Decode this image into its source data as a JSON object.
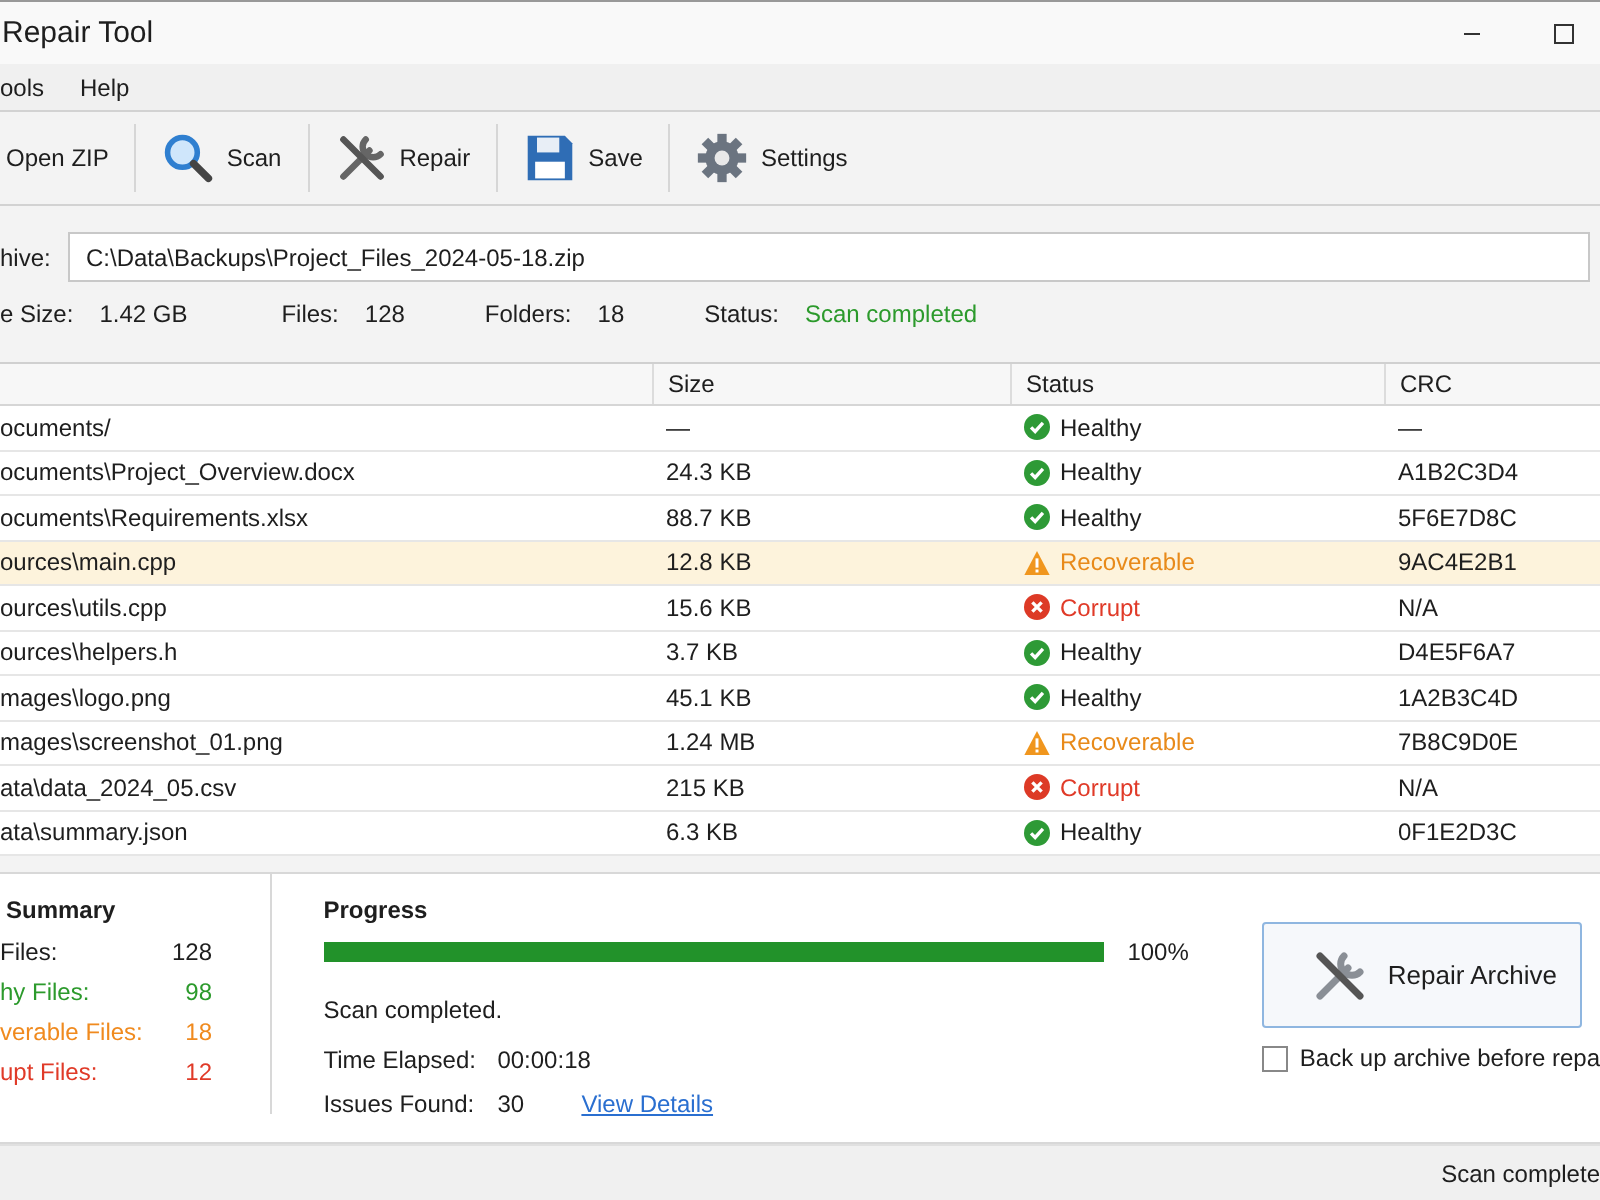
{
  "window": {
    "title": "Repair Tool"
  },
  "menu": [
    {
      "label": "ools"
    },
    {
      "label": "Help"
    }
  ],
  "toolbar": [
    {
      "label": "Open ZIP",
      "kind": "open"
    },
    {
      "label": "Scan",
      "kind": "scan"
    },
    {
      "label": "Repair",
      "kind": "repair"
    },
    {
      "label": "Save",
      "kind": "save"
    },
    {
      "label": "Settings",
      "kind": "settings"
    }
  ],
  "archive": {
    "label": "hive:",
    "value": "C:\\Data\\Backups\\Project_Files_2024-05-18.zip"
  },
  "info": [
    {
      "label": "e Size:",
      "value": "1.42 GB",
      "kind": "plain"
    },
    {
      "label": "Files:",
      "value": "128",
      "kind": "plain"
    },
    {
      "label": "Folders:",
      "value": "18",
      "kind": "plain"
    },
    {
      "label": "Status:",
      "value": "Scan completed",
      "kind": "success"
    }
  ],
  "table": {
    "columns": [
      {
        "label": "Size"
      },
      {
        "label": "Status"
      },
      {
        "label": "CRC"
      }
    ],
    "rows": [
      {
        "column_1": "ocuments/",
        "size": "—",
        "status": "Healthy",
        "kind": "healthy",
        "crc": "—",
        "selected": false
      },
      {
        "column_1": "ocuments\\Project_Overview.docx",
        "size": "24.3 KB",
        "status": "Healthy",
        "kind": "healthy",
        "crc": "A1B2C3D4",
        "selected": false
      },
      {
        "column_1": "ocuments\\Requirements.xlsx",
        "size": "88.7 KB",
        "status": "Healthy",
        "kind": "healthy",
        "crc": "5F6E7D8C",
        "selected": false
      },
      {
        "column_1": "ources\\main.cpp",
        "size": "12.8 KB",
        "status": "Recoverable",
        "kind": "recoverable",
        "crc": "9AC4E2B1",
        "selected": true
      },
      {
        "column_1": "ources\\utils.cpp",
        "size": "15.6 KB",
        "status": "Corrupt",
        "kind": "corrupt",
        "crc": "N/A",
        "selected": false
      },
      {
        "column_1": "ources\\helpers.h",
        "size": "3.7 KB",
        "status": "Healthy",
        "kind": "healthy",
        "crc": "D4E5F6A7",
        "selected": false
      },
      {
        "column_1": "mages\\logo.png",
        "size": "45.1 KB",
        "status": "Healthy",
        "kind": "healthy",
        "crc": "1A2B3C4D",
        "selected": false
      },
      {
        "column_1": "mages\\screenshot_01.png",
        "size": "1.24 MB",
        "status": "Recoverable",
        "kind": "recoverable",
        "crc": "7B8C9D0E",
        "selected": false
      },
      {
        "column_1": "ata\\data_2024_05.csv",
        "size": "215 KB",
        "status": "Corrupt",
        "kind": "corrupt",
        "crc": "N/A",
        "selected": false
      },
      {
        "column_1": "ata\\summary.json",
        "size": "6.3 KB",
        "status": "Healthy",
        "kind": "healthy",
        "crc": "0F1E2D3C",
        "selected": false
      }
    ]
  },
  "summary": {
    "title": "Summary",
    "items": [
      {
        "label": "Files:",
        "value": "128",
        "kind": "total"
      },
      {
        "label": "hy Files:",
        "value": "98",
        "kind": "healthy"
      },
      {
        "label": "verable Files:",
        "value": "18",
        "kind": "recoverable"
      },
      {
        "label": "upt Files:",
        "value": "12",
        "kind": "corrupt"
      }
    ]
  },
  "progress": {
    "title": "Progress",
    "level": 1,
    "reading": "100%",
    "message": "Scan completed.",
    "stats": [
      {
        "label": "Time Elapsed:",
        "value": "00:00:18"
      },
      {
        "label": "Issues Found:",
        "value": "30",
        "link": "View Details"
      }
    ]
  },
  "repair_button": {
    "label": "Repair Archive"
  },
  "backup_checkbox": {
    "label": "Back up archive before repa",
    "checked": false
  },
  "status_bar": {
    "text": "Scan complete"
  }
}
